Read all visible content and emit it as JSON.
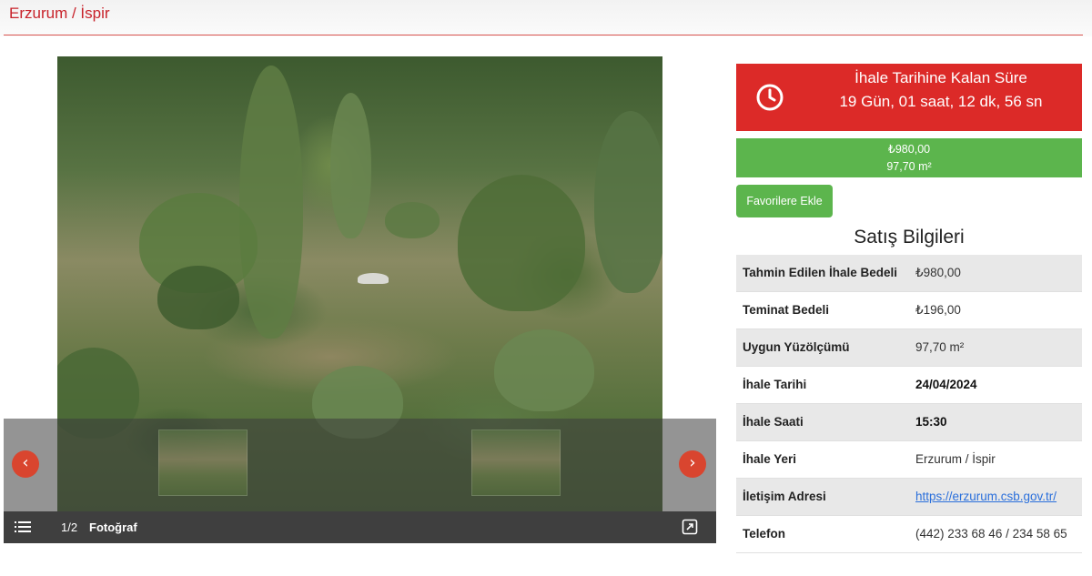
{
  "header": {
    "location": "Erzurum / İspir"
  },
  "gallery": {
    "counter": "1/2",
    "caption": "Fotoğraf",
    "prev_label": "‹",
    "next_label": "›"
  },
  "countdown": {
    "title": "İhale Tarihine Kalan Süre",
    "remaining": "19 Gün, 01 saat, 12 dk, 56 sn"
  },
  "price_box": {
    "price": "₺980,00",
    "area": "97,70 m²"
  },
  "favorite_button": {
    "label": "Favorilere Ekle"
  },
  "sale_info": {
    "title": "Satış Bilgileri",
    "rows": [
      {
        "key": "Tahmin Edilen İhale Bedeli",
        "value": "₺980,00"
      },
      {
        "key": "Teminat Bedeli",
        "value": "₺196,00"
      },
      {
        "key": "Uygun Yüzölçümü",
        "value": "97,70 m²"
      },
      {
        "key": "İhale Tarihi",
        "value": "24/04/2024"
      },
      {
        "key": "İhale Saati",
        "value": "15:30"
      },
      {
        "key": "İhale Yeri",
        "value": "Erzurum / İspir"
      },
      {
        "key": "İletişim Adresi",
        "value": "https://erzurum.csb.gov.tr/"
      },
      {
        "key": "Telefon",
        "value": "(442) 233 68 46 / 234 58 65"
      }
    ]
  },
  "colors": {
    "accent_red": "#dc2a28",
    "accent_green": "#5cb54d",
    "link_blue": "#2a6fdb"
  }
}
